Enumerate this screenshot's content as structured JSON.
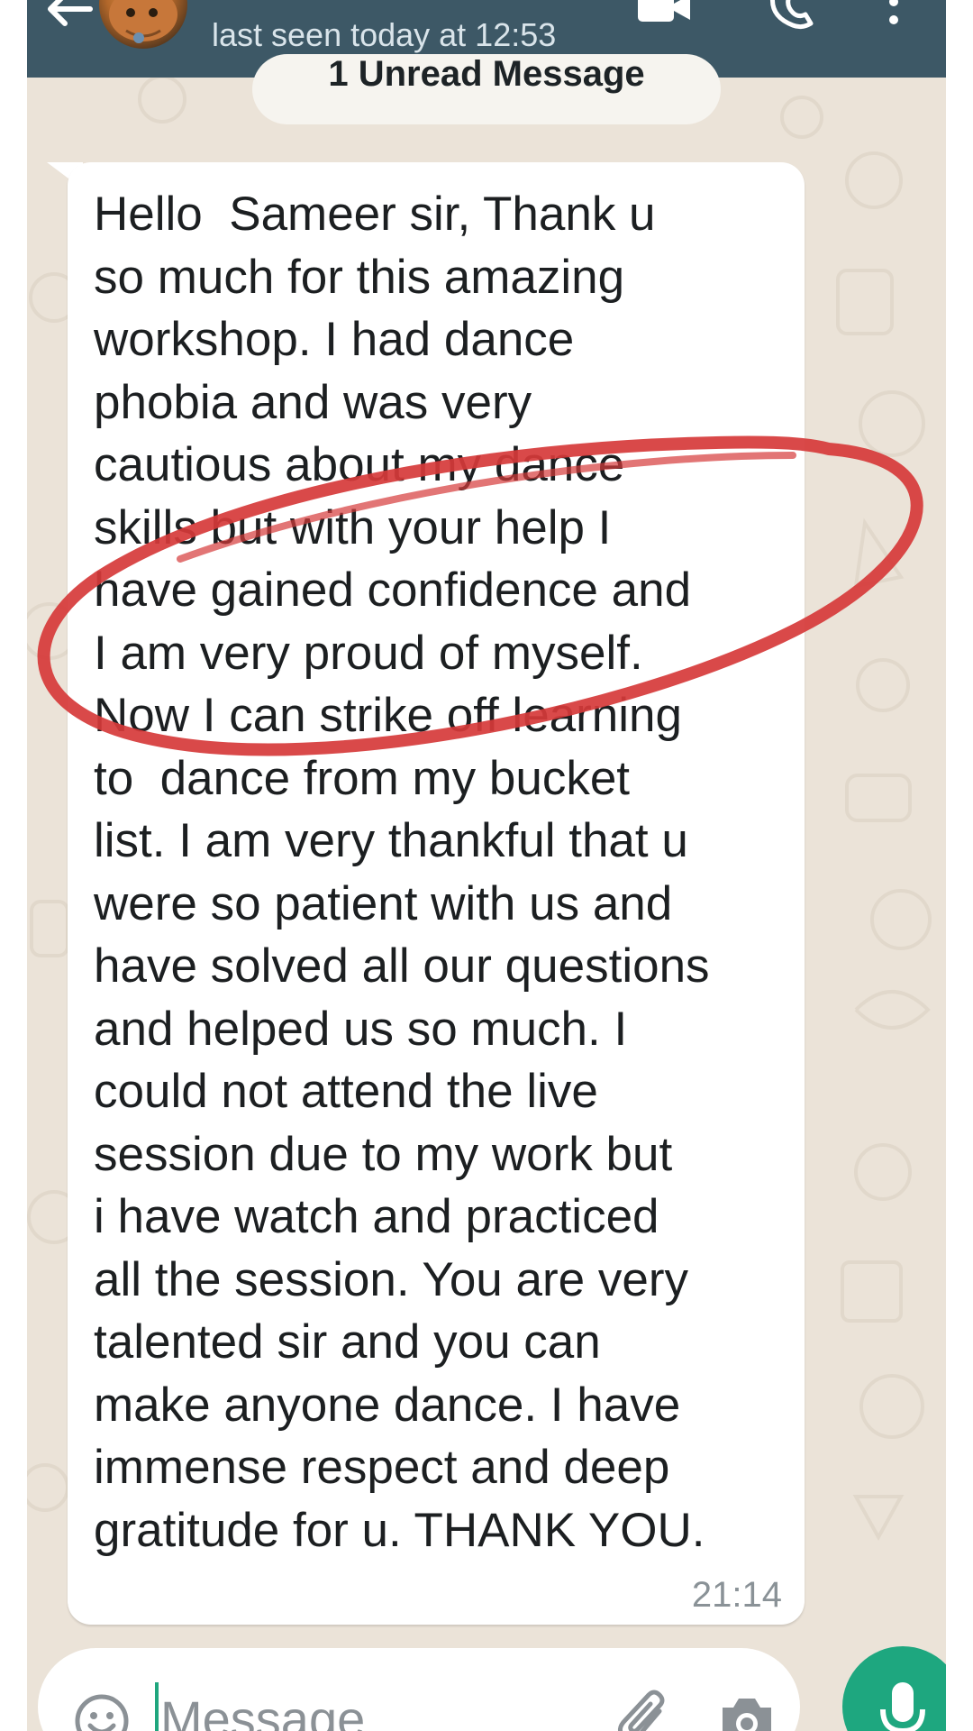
{
  "header": {
    "status": "last seen today at 12:53",
    "icons": [
      "back-arrow-icon",
      "contact-avatar",
      "video-call-icon",
      "voice-call-icon",
      "more-options-icon"
    ]
  },
  "chat": {
    "unread_banner": "1 Unread Message",
    "message": {
      "text": "Hello  Sameer sir, Thank u\nso much for this amazing\nworkshop. I had dance\nphobia and was very\ncautious about my dance\nskills but with your help I\nhave gained confidence and\nI am very proud of myself.\nNow I can strike off learning\nto  dance from my bucket\nlist. I am very thankful that u\nwere so patient with us and\nhave solved all our questions\nand helped us so much. I\ncould not attend the live\nsession due to my work but\ni have watch and practiced\nall the session. You are very\ntalented sir and you can\nmake anyone dance. I have\nimmense respect and deep\ngratitude for u. THANK YOU.",
      "time": "21:14"
    },
    "annotation": {
      "shape": "hand-drawn ellipse",
      "color": "#d63a3a"
    }
  },
  "composer": {
    "placeholder": "Message",
    "icons": [
      "emoji-icon",
      "attach-icon",
      "camera-icon",
      "mic-icon"
    ],
    "accent_color": "#1ea77f"
  },
  "colors": {
    "header_bg": "#3d5866",
    "chat_bg": "#ebe3d8",
    "bubble_bg": "#ffffff"
  }
}
